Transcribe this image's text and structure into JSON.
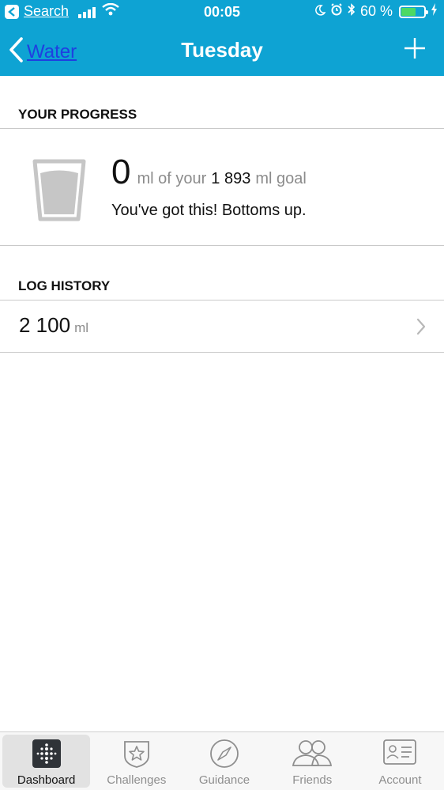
{
  "status_bar": {
    "back_app": "Search",
    "time": "00:05",
    "battery_percent": "60 %",
    "battery_level": 0.6
  },
  "nav": {
    "back_label": "Water",
    "title": "Tuesday"
  },
  "progress": {
    "section_title": "YOUR PROGRESS",
    "current_value": "0",
    "mid_text": "ml of your",
    "goal_value": "1 893",
    "goal_unit": "ml goal",
    "message": "You've got this! Bottoms up."
  },
  "log_history": {
    "section_title": "LOG HISTORY",
    "entries": [
      {
        "amount": "2 100",
        "unit": "ml"
      }
    ]
  },
  "tabs": [
    {
      "label": "Dashboard",
      "icon": "dashboard-icon",
      "active": true
    },
    {
      "label": "Challenges",
      "icon": "star-badge-icon",
      "active": false
    },
    {
      "label": "Guidance",
      "icon": "compass-icon",
      "active": false
    },
    {
      "label": "Friends",
      "icon": "friends-icon",
      "active": false
    },
    {
      "label": "Account",
      "icon": "account-card-icon",
      "active": false
    }
  ],
  "colors": {
    "header": "#0ea3d3",
    "battery_fill": "#4cd964",
    "link_blue": "#1f3fe0"
  }
}
